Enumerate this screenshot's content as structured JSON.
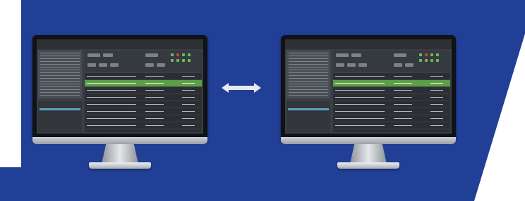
{
  "colors": {
    "background_blue": "#213f96",
    "white_panel": "#ffffff",
    "highlight_row": "#5c9f47",
    "arrow": "#e6e9ee"
  },
  "monitors": [
    {
      "name": "left-monitor",
      "highlighted_row_index": 1,
      "row_count": 8
    },
    {
      "name": "right-monitor",
      "highlighted_row_index": 1,
      "row_count": 8
    }
  ],
  "icons": {
    "arrow": "double-arrow-icon"
  }
}
